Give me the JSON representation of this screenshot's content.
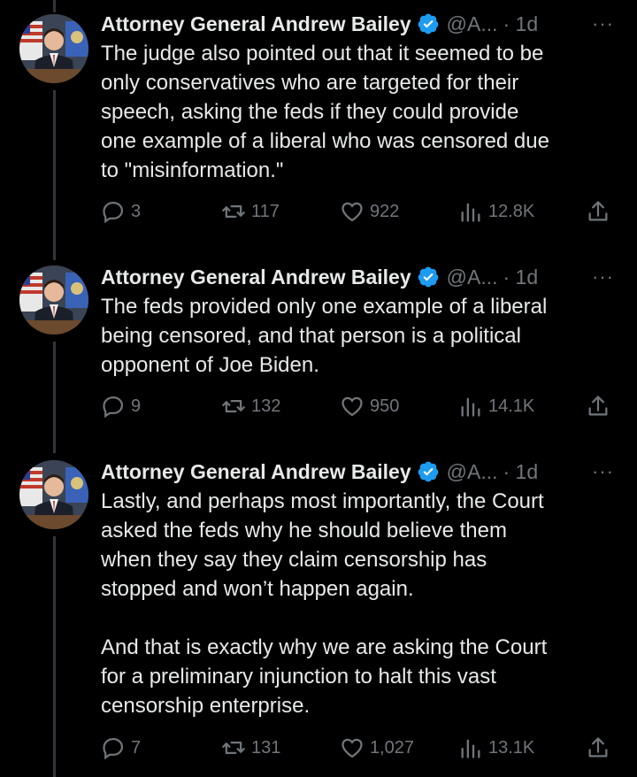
{
  "tweets": [
    {
      "author": "Attorney General Andrew Bailey",
      "handle": "@A...",
      "time": "· 1d",
      "text": "The judge also pointed out that it seemed to be\nonly conservatives who are targeted for their\nspeech, asking the feds if they could provide\none example of a liberal who was censored due\nto \"misinformation.\"",
      "replies": "3",
      "retweets": "117",
      "likes": "922",
      "views": "12.8K"
    },
    {
      "author": "Attorney General Andrew Bailey",
      "handle": "@A...",
      "time": "· 1d",
      "text": "The feds provided only one example of a liberal\nbeing censored, and that person is a political\nopponent of Joe Biden.",
      "replies": "9",
      "retweets": "132",
      "likes": "950",
      "views": "14.1K"
    },
    {
      "author": "Attorney General Andrew Bailey",
      "handle": "@A...",
      "time": "· 1d",
      "text": "Lastly, and perhaps most importantly, the Court\nasked the feds why he should believe them\nwhen they say they claim censorship has\nstopped and won’t happen again.\n\nAnd that is exactly why we are asking the Court\nfor a preliminary injunction to halt this vast\ncensorship enterprise.",
      "replies": "7",
      "retweets": "131",
      "likes": "1,027",
      "views": "13.1K"
    }
  ],
  "more_label": "···",
  "colors": {
    "background": "#000000",
    "text": "#e7e9ea",
    "muted": "#71767b",
    "verified": "#1d9bf0",
    "thread_line": "#333639"
  },
  "icons": {
    "reply": "reply-icon",
    "retweet": "retweet-icon",
    "like": "heart-icon",
    "views": "views-icon",
    "share": "share-icon",
    "verified": "verified-badge-icon"
  }
}
